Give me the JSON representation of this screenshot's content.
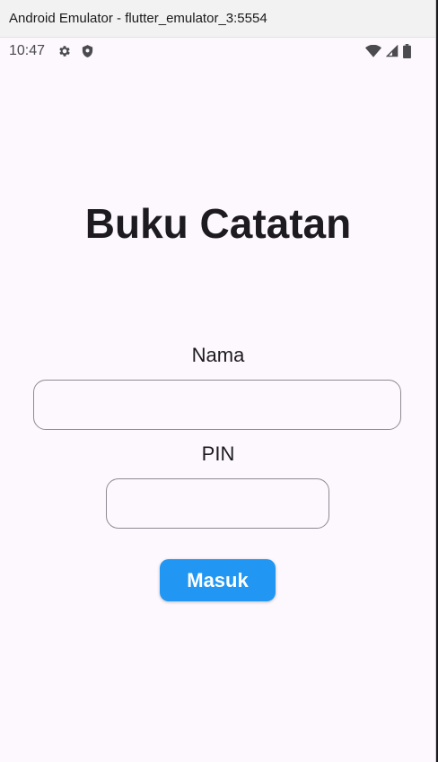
{
  "window": {
    "title": "Android Emulator - flutter_emulator_3:5554"
  },
  "status_bar": {
    "time": "10:47",
    "left_icons": [
      "gear-icon",
      "shield-icon"
    ],
    "right_icons": [
      "wifi-icon",
      "cell-signal-icon",
      "battery-icon"
    ]
  },
  "app": {
    "title": "Buku Catatan",
    "nama_label": "Nama",
    "nama_value": "",
    "pin_label": "PIN",
    "pin_value": "",
    "login_button_label": "Masuk"
  },
  "colors": {
    "background": "#fdf8fd",
    "button": "#2196f3",
    "field_border": "#8f8a93",
    "text": "#1d1b20"
  }
}
